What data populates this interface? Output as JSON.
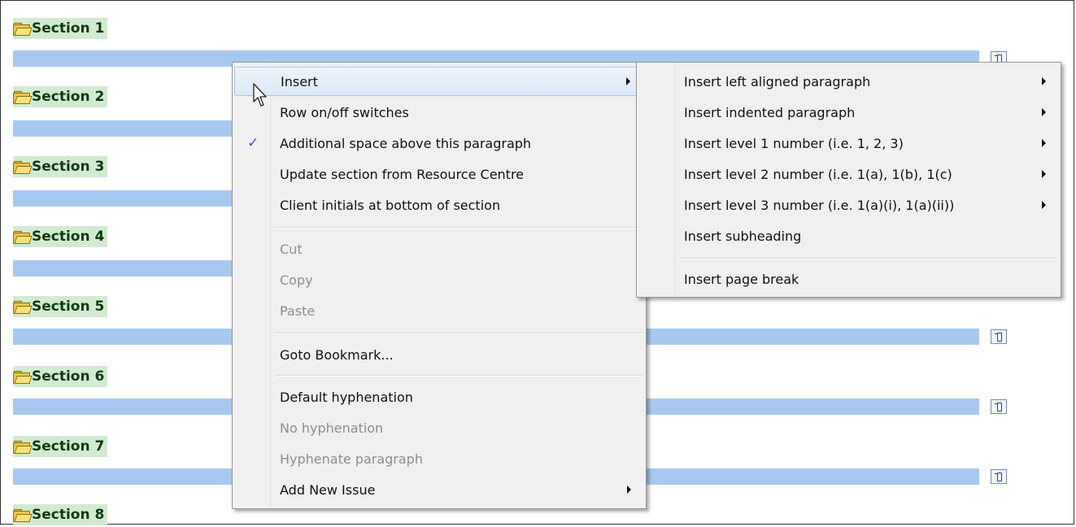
{
  "sections": [
    {
      "label": "Section 1"
    },
    {
      "label": "Section 2"
    },
    {
      "label": "Section 3"
    },
    {
      "label": "Section 4"
    },
    {
      "label": "Section 5"
    },
    {
      "label": "Section 6"
    },
    {
      "label": "Section 7"
    },
    {
      "label": "Section 8"
    }
  ],
  "context_menu": {
    "items": [
      {
        "label": "Insert",
        "submenu": true,
        "highlighted": true
      },
      {
        "label": "Row on/off switches"
      },
      {
        "label": "Additional space above this paragraph",
        "checked": true
      },
      {
        "label": "Update section from Resource Centre"
      },
      {
        "label": "Client initials at bottom of section"
      },
      {
        "label": "Cut",
        "disabled": true
      },
      {
        "label": "Copy",
        "disabled": true
      },
      {
        "label": "Paste",
        "disabled": true
      },
      {
        "label": "Goto Bookmark..."
      },
      {
        "label": "Default hyphenation"
      },
      {
        "label": "No hyphenation",
        "disabled": true
      },
      {
        "label": "Hyphenate paragraph",
        "disabled": true
      },
      {
        "label": "Add New Issue",
        "submenu": true
      }
    ]
  },
  "insert_submenu": {
    "items": [
      {
        "label": "Insert left aligned paragraph",
        "submenu": true
      },
      {
        "label": "Insert indented paragraph",
        "submenu": true
      },
      {
        "label": "Insert level 1 number (i.e. 1, 2, 3)",
        "submenu": true
      },
      {
        "label": "Insert level 2 number (i.e. 1(a), 1(b), 1(c)",
        "submenu": true
      },
      {
        "label": "Insert level 3 number (i.e. 1(a)(i), 1(a)(ii))",
        "submenu": true
      },
      {
        "label": "Insert subheading"
      },
      {
        "label": "Insert page break"
      }
    ]
  },
  "colors": {
    "section_bg": "#d3ead2",
    "bar": "#a7c9ef",
    "menu_bg": "#f0f0f0",
    "check": "#2a5fc8"
  },
  "icons": {
    "section": "folder-icon",
    "bar": "edit-paragraph-icon",
    "check": "checkmark-icon",
    "submenu": "submenu-arrow-icon"
  }
}
